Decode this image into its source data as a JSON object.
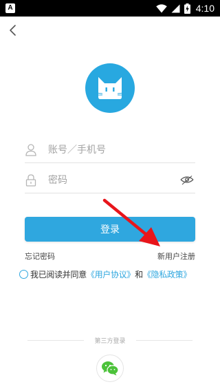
{
  "status_bar": {
    "app_badge": "A",
    "time": "4:10"
  },
  "login": {
    "account_placeholder": "账号／手机号",
    "password_placeholder": "密码",
    "login_label": "登录",
    "forgot_label": "忘记密码",
    "register_label": "新用户注册"
  },
  "agreement": {
    "prefix": "我已阅读并同意",
    "user_agreement": "《用户协议》",
    "connector": "和",
    "privacy_policy": "《隐私政策》"
  },
  "third_party": {
    "label": "第三方登录"
  },
  "colors": {
    "accent": "#2fa7df",
    "logo_bg": "#28a8e0",
    "wechat_green": "#4cc23a",
    "annotation_arrow": "#e8151b"
  },
  "icons": {
    "back": "chevron-left-icon",
    "user": "user-icon",
    "lock": "lock-icon",
    "eye": "eye-icon",
    "wechat": "wechat-icon"
  }
}
